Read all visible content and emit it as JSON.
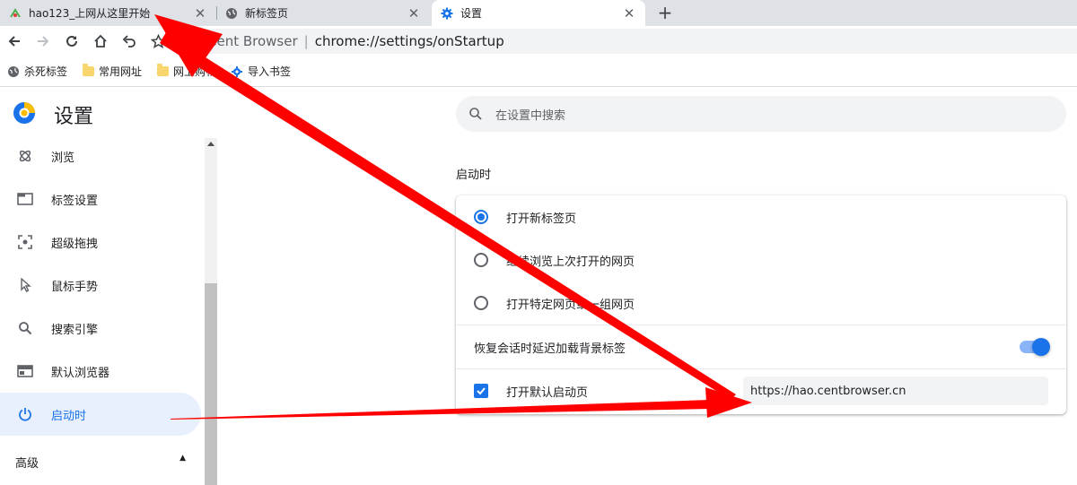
{
  "tabs": [
    {
      "title": "hao123_上网从这里开始",
      "favicon": "hao123-favicon",
      "active": false
    },
    {
      "title": "新标签页",
      "favicon": "globe-icon",
      "active": false
    },
    {
      "title": "设置",
      "favicon": "gear-icon",
      "active": true
    }
  ],
  "toolbar": {
    "site_name": "Cent Browser",
    "url": "chrome://settings/onStartup"
  },
  "bookmarks": [
    {
      "label": "杀死标签",
      "icon": "globe-icon"
    },
    {
      "label": "常用网址",
      "icon": "folder-icon"
    },
    {
      "label": "网上购物",
      "icon": "folder-icon"
    },
    {
      "label": "导入书签",
      "icon": "import-gear-icon"
    }
  ],
  "header": {
    "title": "设置",
    "search_placeholder": "在设置中搜索"
  },
  "sidebar": {
    "items": [
      {
        "label": "浏览",
        "icon": "atom-icon",
        "active": false
      },
      {
        "label": "标签设置",
        "icon": "tab-icon",
        "active": false
      },
      {
        "label": "超级拖拽",
        "icon": "drag-target-icon",
        "active": false
      },
      {
        "label": "鼠标手势",
        "icon": "cursor-icon",
        "active": false
      },
      {
        "label": "搜索引擎",
        "icon": "search-icon",
        "active": false
      },
      {
        "label": "默认浏览器",
        "icon": "browser-window-icon",
        "active": false
      },
      {
        "label": "启动时",
        "icon": "power-icon",
        "active": true
      }
    ],
    "advanced_label": "高级"
  },
  "startup": {
    "section_title": "启动时",
    "options": [
      {
        "label": "打开新标签页",
        "selected": true
      },
      {
        "label": "继续浏览上次打开的网页",
        "selected": false
      },
      {
        "label": "打开特定网页或一组网页",
        "selected": false
      }
    ],
    "lazy_load_label": "恢复会话时延迟加载背景标签",
    "lazy_load_enabled": true,
    "default_page_label": "打开默认启动页",
    "default_page_checked": true,
    "default_page_url": "https://hao.centbrowser.cn"
  },
  "colors": {
    "accent": "#1a73e8",
    "annotation": "#ff0000"
  }
}
